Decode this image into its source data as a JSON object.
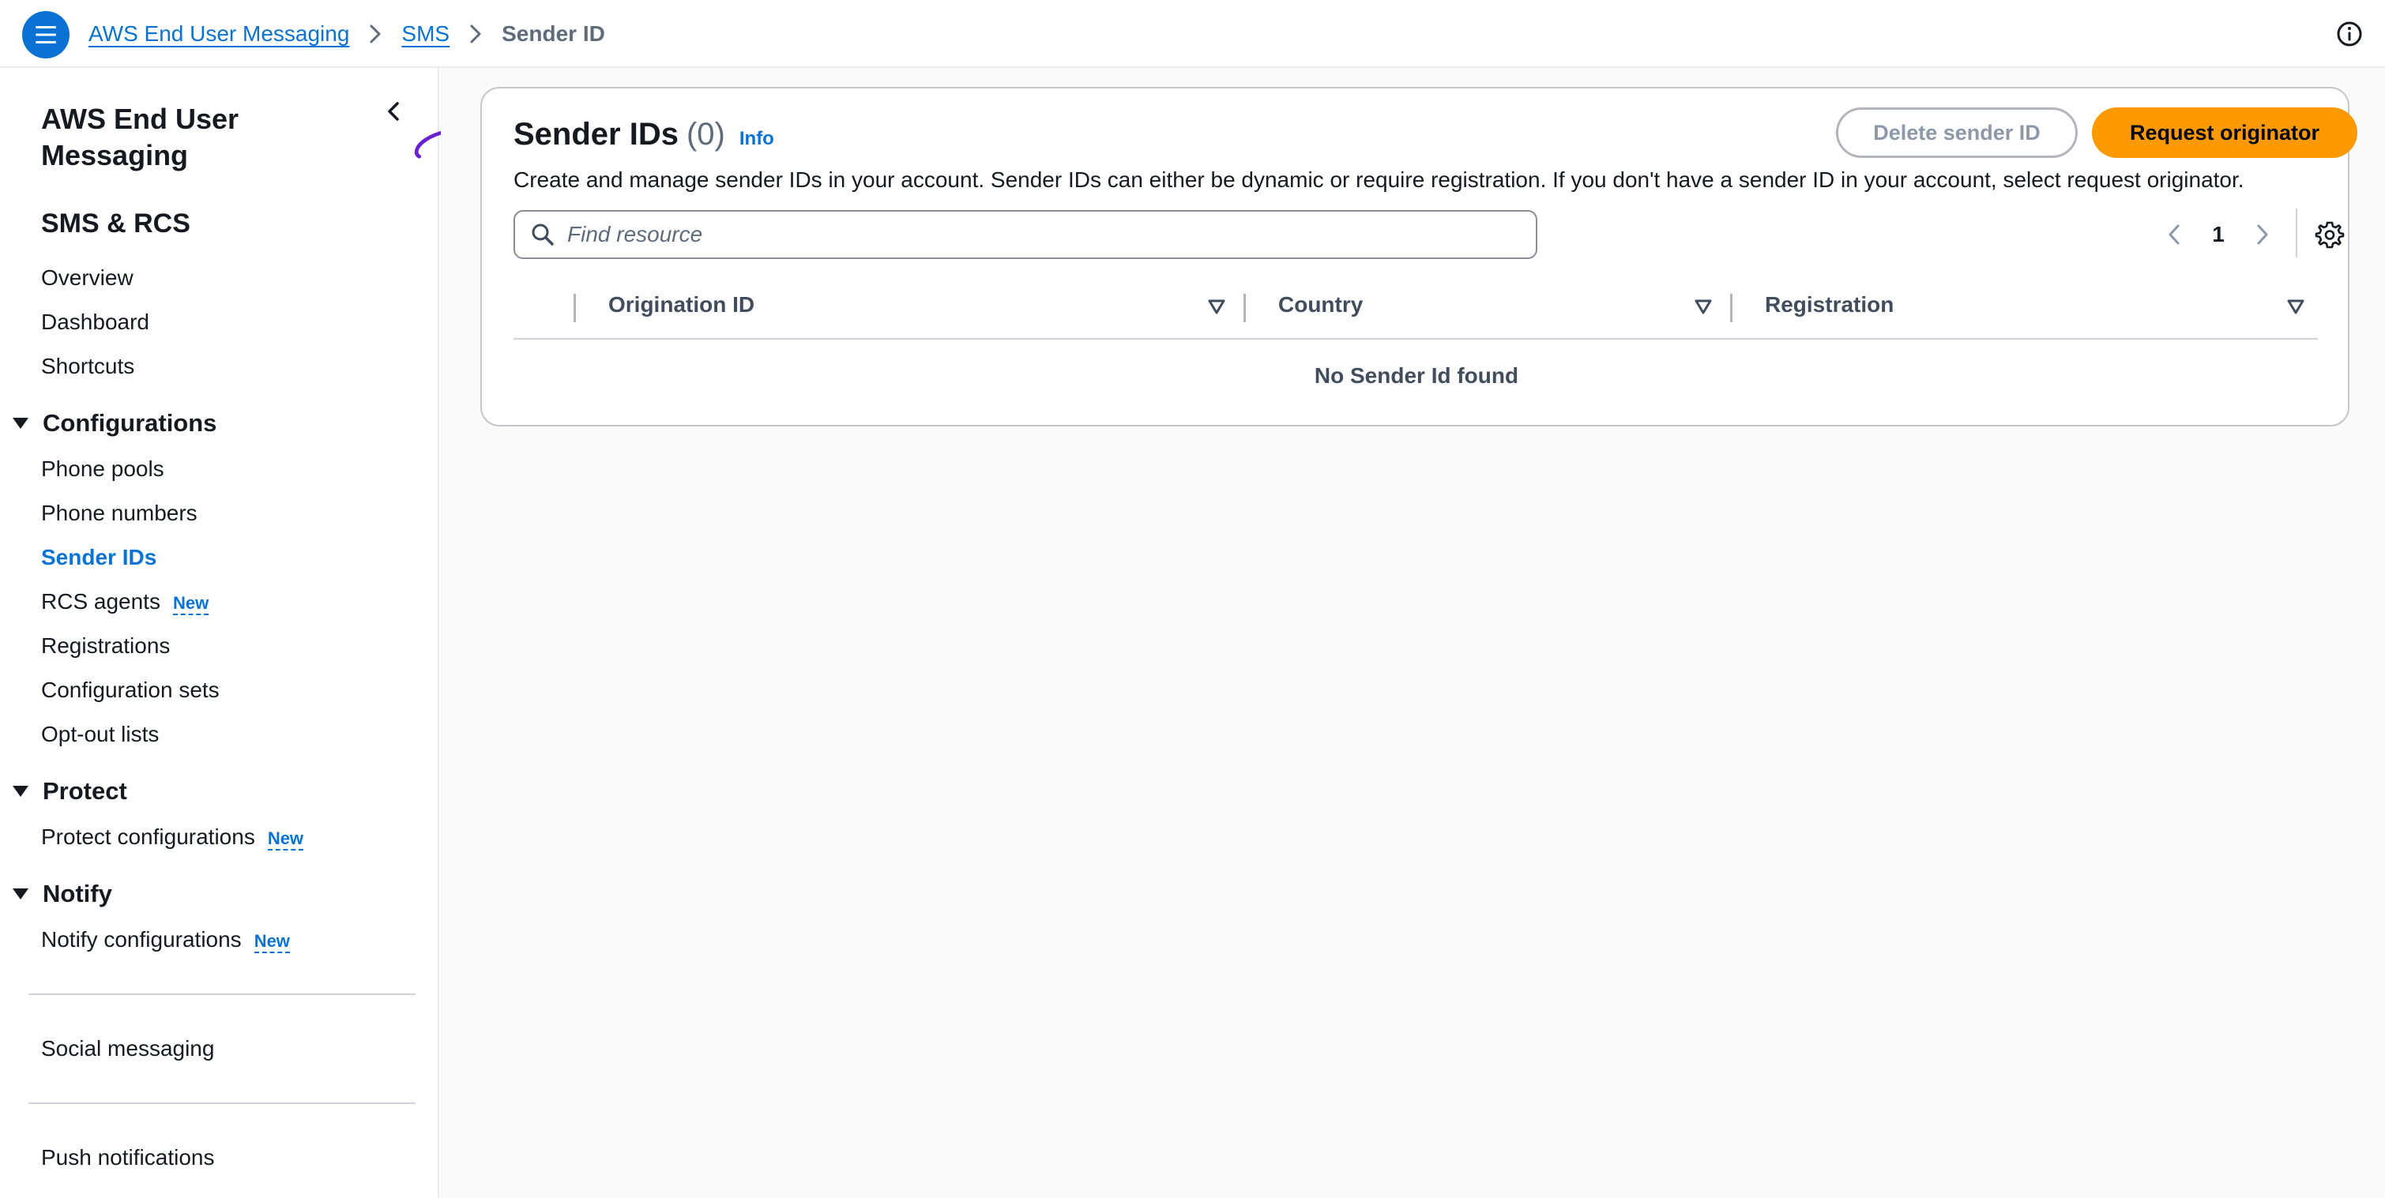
{
  "breadcrumb": {
    "items": [
      "AWS End User Messaging",
      "SMS"
    ],
    "current": "Sender ID"
  },
  "sidebar": {
    "title": "AWS End User Messaging",
    "section": "SMS & RCS",
    "top_links": [
      "Overview",
      "Dashboard",
      "Shortcuts"
    ],
    "groups": [
      {
        "label": "Configurations",
        "items": [
          {
            "label": "Phone pools"
          },
          {
            "label": "Phone numbers"
          },
          {
            "label": "Sender IDs",
            "active": true
          },
          {
            "label": "RCS agents",
            "badge": "New"
          },
          {
            "label": "Registrations"
          },
          {
            "label": "Configuration sets"
          },
          {
            "label": "Opt-out lists"
          }
        ]
      },
      {
        "label": "Protect",
        "items": [
          {
            "label": "Protect configurations",
            "badge": "New"
          }
        ]
      },
      {
        "label": "Notify",
        "items": [
          {
            "label": "Notify configurations",
            "badge": "New"
          }
        ]
      }
    ],
    "footer_links": [
      "Social messaging",
      "Push notifications"
    ]
  },
  "main": {
    "title": "Sender IDs",
    "count": "(0)",
    "info_label": "Info",
    "description": "Create and manage sender IDs in your account. Sender IDs can either be dynamic or require registration. If you don't have a sender ID in your account, select request originator.",
    "delete_button": "Delete sender ID",
    "request_button": "Request originator",
    "search_placeholder": "Find resource",
    "page": "1",
    "columns": [
      "Origination ID",
      "Country",
      "Registration"
    ],
    "empty_message": "No Sender Id found"
  },
  "colors": {
    "accent": "#0972d3",
    "primary_button": "#ff9900",
    "annotation_arrow": "#6a1fd0"
  }
}
